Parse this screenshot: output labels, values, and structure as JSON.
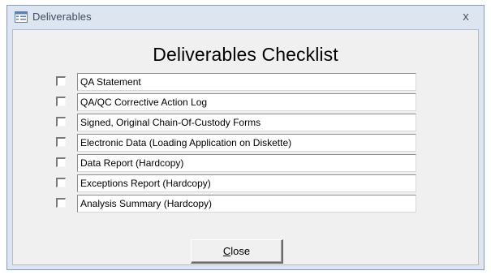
{
  "window": {
    "title": "Deliverables",
    "close_glyph": "x",
    "icon": "form-icon"
  },
  "form": {
    "heading": "Deliverables Checklist",
    "items": [
      {
        "label": "QA Statement",
        "checked": false
      },
      {
        "label": "QA/QC Corrective Action Log",
        "checked": false
      },
      {
        "label": "Signed, Original Chain-Of-Custody Forms",
        "checked": false
      },
      {
        "label": "Electronic Data (Loading Application on Diskette)",
        "checked": false
      },
      {
        "label": "Data Report (Hardcopy)",
        "checked": false
      },
      {
        "label": "Exceptions Report (Hardcopy)",
        "checked": false
      },
      {
        "label": "Analysis Summary (Hardcopy)",
        "checked": false
      }
    ],
    "close_button": {
      "accel": "C",
      "rest": "lose"
    }
  },
  "colors": {
    "title_bar": "#dde5f0",
    "client_bg": "#f0f0f0",
    "title_text": "#3e4b5f"
  }
}
